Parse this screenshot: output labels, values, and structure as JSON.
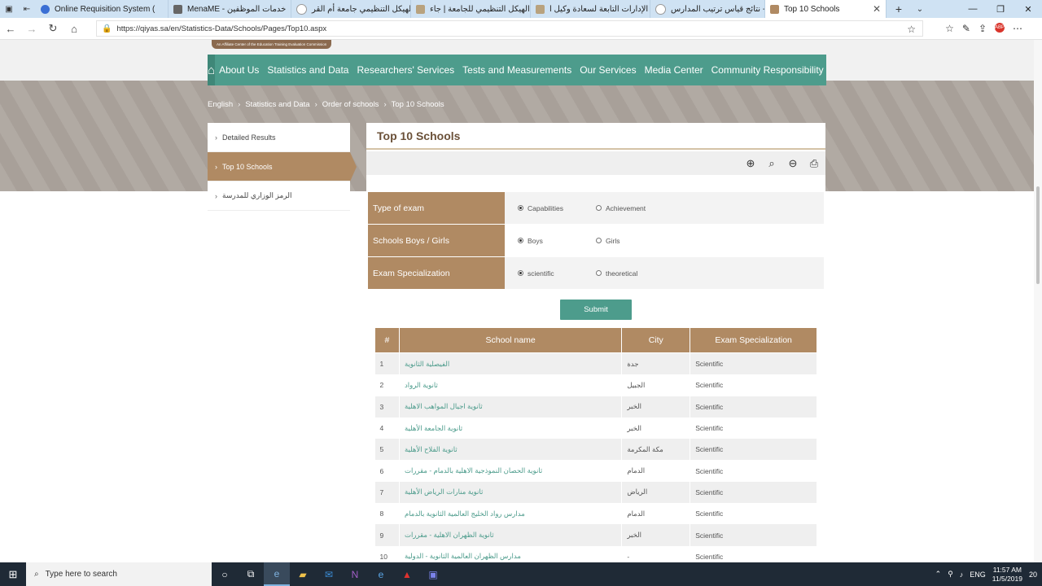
{
  "browser": {
    "tabs": [
      {
        "title": "Online Requisition System (",
        "active": false
      },
      {
        "title": "MenaME - خدمات الموظفين",
        "active": false
      },
      {
        "title": "الهيكل التنظيمي جامعة أم القر",
        "active": false
      },
      {
        "title": "الهيكل التنظيمي للجامعة | جاء",
        "active": false
      },
      {
        "title": "الإدارات التابعة لسعادة وكيل ا",
        "active": false
      },
      {
        "title": "نتائج قياس ترتيب المدارس - G",
        "active": false
      },
      {
        "title": "Top 10 Schools",
        "active": true
      }
    ],
    "url": "https://qiyas.sa/en/Statistics-Data/Schools/Pages/Top10.aspx",
    "new_tab": "+"
  },
  "site": {
    "tagline": "An Affiliate Center of the Education Training Evaluation Commission",
    "nav": [
      "About Us",
      "Statistics and Data",
      "Researchers' Services",
      "Tests and Measurements",
      "Our Services",
      "Media Center",
      "Community Responsibility"
    ],
    "breadcrumb": [
      "English",
      "Statistics and Data",
      "Order of schools",
      "Top 10 Schools"
    ]
  },
  "sidebar": {
    "items": [
      {
        "label": "Detailed Results",
        "active": false
      },
      {
        "label": "Top 10 Schools",
        "active": true
      },
      {
        "label": "الرمز الوزاري للمدرسة",
        "active": false
      }
    ]
  },
  "main": {
    "title": "Top 10 Schools",
    "filters": [
      {
        "label": "Type of exam",
        "options": [
          "Capabilities",
          "Achievement"
        ],
        "selected": "Capabilities"
      },
      {
        "label": "Schools Boys / Girls",
        "options": [
          "Boys",
          "Girls"
        ],
        "selected": "Boys"
      },
      {
        "label": "Exam Specialization",
        "options": [
          "scientific",
          "theoretical"
        ],
        "selected": "scientific"
      }
    ],
    "submit_label": "Submit",
    "table": {
      "headers": [
        "#",
        "School name",
        "City",
        "Exam Specialization"
      ],
      "rows": [
        [
          "1",
          "الفيصلية الثانوية",
          "جدة",
          "Scientific"
        ],
        [
          "2",
          "ثانوية الرواد",
          "الجبيل",
          "Scientific"
        ],
        [
          "3",
          "ثانوية اجيال المواهب الاهلية",
          "الخبر",
          "Scientific"
        ],
        [
          "4",
          "ثانوية الجامعة الأهلية",
          "الخبر",
          "Scientific"
        ],
        [
          "5",
          "ثانوية الفلاح الأهلية",
          "مكة المكرمة",
          "Scientific"
        ],
        [
          "6",
          "ثانوية الحصان النموذجية الاهلية بالدمام - مقررات",
          "الدمام",
          "Scientific"
        ],
        [
          "7",
          "ثانوية منارات الرياض الأهلية",
          "الرياض",
          "Scientific"
        ],
        [
          "8",
          "مدارس رواد الخليج العالمية الثانوية بالدمام",
          "الدمام",
          "Scientific"
        ],
        [
          "9",
          "ثانوية الظهران الاهلية - مقررات",
          "الخبر",
          "Scientific"
        ],
        [
          "10",
          "مدارس الظهران العالمية الثانوية - الدولية",
          "-",
          "Scientific"
        ]
      ]
    }
  },
  "taskbar": {
    "search_placeholder": "Type here to search",
    "lang": "ENG",
    "time": "11:57 AM",
    "date": "11/5/2019",
    "notifications": "20"
  },
  "colors": {
    "teal": "#4d9c8c",
    "brown": "#b08a63",
    "hero": "#ada59e"
  }
}
